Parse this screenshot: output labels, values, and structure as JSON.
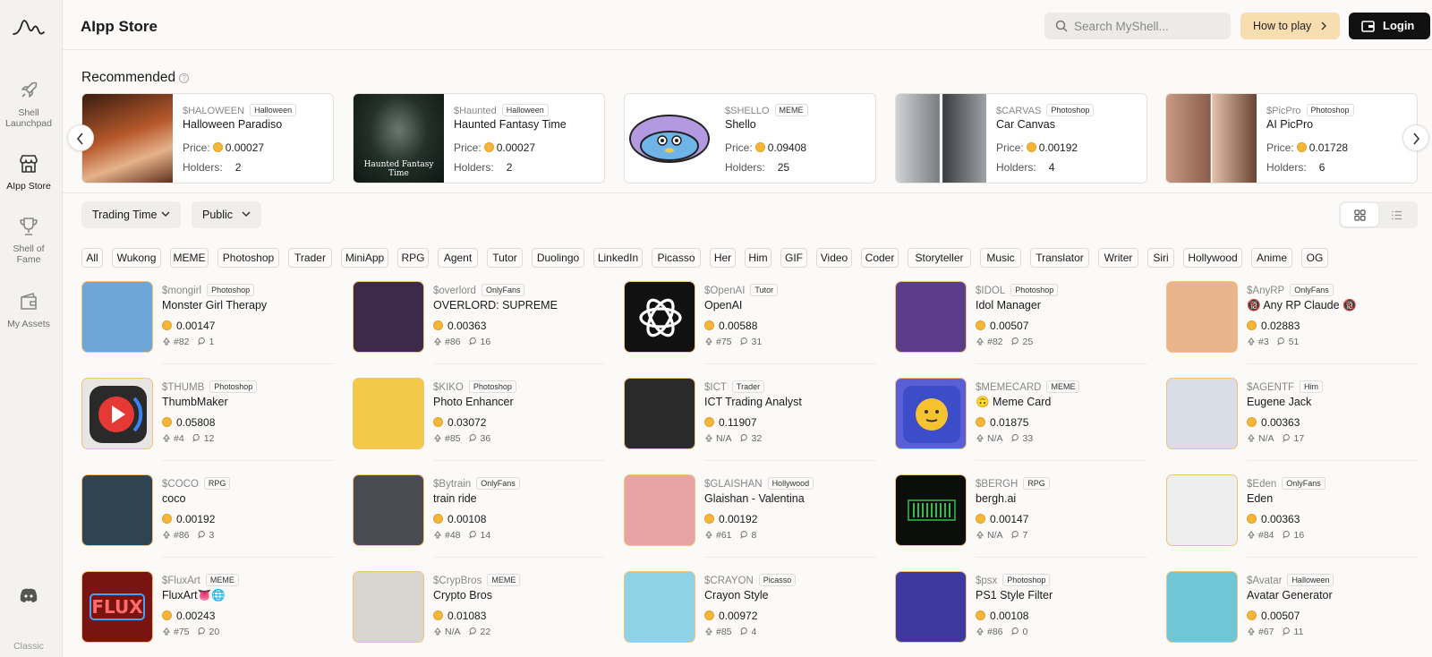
{
  "app": {
    "title": "AIpp Store"
  },
  "sidebar": {
    "items": [
      {
        "label_line1": "Shell",
        "label_line2": "Launchpad",
        "icon": "rocket-icon"
      },
      {
        "label_line1": "AIpp Store",
        "label_line2": "",
        "icon": "store-icon"
      },
      {
        "label_line1": "Shell of",
        "label_line2": "Fame",
        "icon": "trophy-icon"
      },
      {
        "label_line1": "My Assets",
        "label_line2": "",
        "icon": "wallet-icon"
      }
    ],
    "classic": "Classic"
  },
  "header": {
    "search_placeholder": "Search MyShell...",
    "how_to_play": "How to play",
    "login": "Login"
  },
  "recommended": {
    "title": "Recommended",
    "price_label": "Price:",
    "holders_label": "Holders:",
    "cards": [
      {
        "symbol": "$HALOWEEN",
        "tag": "Halloween",
        "name": "Halloween Paradiso",
        "price": "0.00027",
        "holders": "2",
        "img": "#7a3a20"
      },
      {
        "symbol": "$Haunted",
        "tag": "Halloween",
        "name": "Haunted Fantasy Time",
        "price": "0.00027",
        "holders": "2",
        "img": "#1d2a24",
        "caption": "Haunted Fantasy Time"
      },
      {
        "symbol": "$SHELLO",
        "tag": "MEME",
        "name": "Shello",
        "price": "0.09408",
        "holders": "25",
        "img": "#ffffff"
      },
      {
        "symbol": "$CARVAS",
        "tag": "Photoshop",
        "name": "Car Canvas",
        "price": "0.00192",
        "holders": "4",
        "img": "#8a8a8a"
      },
      {
        "symbol": "$PicPro",
        "tag": "Photoshop",
        "name": "AI PicPro",
        "price": "0.01728",
        "holders": "6",
        "img": "#b08a78"
      }
    ]
  },
  "filters": {
    "trading_time": "Trading Time",
    "visibility": "Public"
  },
  "categories": [
    "All",
    "Wukong",
    "MEME",
    "Photoshop",
    "Trader",
    "MiniApp",
    "RPG",
    "Agent",
    "Tutor",
    "Duolingo",
    "LinkedIn",
    "Picasso",
    "Her",
    "Him",
    "GIF",
    "Video",
    "Coder",
    "Storyteller",
    "Music",
    "Translator",
    "Writer",
    "Siri",
    "Hollywood",
    "Anime",
    "OG"
  ],
  "items": [
    {
      "symbol": "$mongirl",
      "tag": "Photoshop",
      "name": "Monster Girl Therapy",
      "price": "0.00147",
      "rank": "#82",
      "comments": "1",
      "color": "#6fa6d8"
    },
    {
      "symbol": "$overlord",
      "tag": "OnlyFans",
      "name": "OVERLORD: SUPREME",
      "price": "0.00363",
      "rank": "#86",
      "comments": "16",
      "color": "#3b2a4a"
    },
    {
      "symbol": "$OpenAI",
      "tag": "Tutor",
      "name": "OpenAI",
      "price": "0.00588",
      "rank": "#75",
      "comments": "31",
      "color": "#111111"
    },
    {
      "symbol": "$IDOL",
      "tag": "Photoshop",
      "name": "Idol Manager",
      "price": "0.00507",
      "rank": "#82",
      "comments": "25",
      "color": "#5a3c8a"
    },
    {
      "symbol": "$AnyRP",
      "tag": "OnlyFans",
      "name": "🔞 Any RP Claude 🔞",
      "price": "0.02883",
      "rank": "#3",
      "comments": "51",
      "color": "#e9b48a"
    },
    {
      "symbol": "$THUMB",
      "tag": "Photoshop",
      "name": "ThumbMaker",
      "price": "0.05808",
      "rank": "#4",
      "comments": "12",
      "color": "#e8e6e3"
    },
    {
      "symbol": "$KIKO",
      "tag": "Photoshop",
      "name": "Photo Enhancer",
      "price": "0.03072",
      "rank": "#85",
      "comments": "36",
      "color": "#f3c94a"
    },
    {
      "symbol": "$ICT",
      "tag": "Trader",
      "name": "ICT Trading Analyst",
      "price": "0.11907",
      "rank": "N/A",
      "comments": "32",
      "color": "#2a2a2a"
    },
    {
      "symbol": "$MEMECARD",
      "tag": "MEME",
      "name": "🙃 Meme Card",
      "price": "0.01875",
      "rank": "N/A",
      "comments": "33",
      "color": "#5b5fd6"
    },
    {
      "symbol": "$AGENTF",
      "tag": "Him",
      "name": "Eugene Jack",
      "price": "0.00363",
      "rank": "N/A",
      "comments": "17",
      "color": "#d9dde6"
    },
    {
      "symbol": "$COCO",
      "tag": "RPG",
      "name": "coco",
      "price": "0.00192",
      "rank": "#86",
      "comments": "3",
      "color": "#2f4450"
    },
    {
      "symbol": "$Bytrain",
      "tag": "OnlyFans",
      "name": "train ride",
      "price": "0.00108",
      "rank": "#48",
      "comments": "14",
      "color": "#4a4a52"
    },
    {
      "symbol": "$GLAISHAN",
      "tag": "Hollywood",
      "name": "Glaishan - Valentina",
      "price": "0.00192",
      "rank": "#61",
      "comments": "8",
      "color": "#e8a4a4"
    },
    {
      "symbol": "$BERGH",
      "tag": "RPG",
      "name": "bergh.ai",
      "price": "0.00147",
      "rank": "N/A",
      "comments": "7",
      "color": "#0b0f0b"
    },
    {
      "symbol": "$Eden",
      "tag": "OnlyFans",
      "name": "Eden",
      "price": "0.00363",
      "rank": "#84",
      "comments": "16",
      "color": "#eeeeee"
    },
    {
      "symbol": "$FluxArt",
      "tag": "MEME",
      "name": "FluxArt👅🌐",
      "price": "0.00243",
      "rank": "#75",
      "comments": "20",
      "color": "#7a1410"
    },
    {
      "symbol": "$CrypBros",
      "tag": "MEME",
      "name": "Crypto Bros",
      "price": "0.01083",
      "rank": "N/A",
      "comments": "22",
      "color": "#d8d6d0"
    },
    {
      "symbol": "$CRAYON",
      "tag": "Picasso",
      "name": "Crayon Style",
      "price": "0.00972",
      "rank": "#85",
      "comments": "4",
      "color": "#8fd2e6"
    },
    {
      "symbol": "$psx",
      "tag": "Photoshop",
      "name": "PS1 Style Filter",
      "price": "0.00108",
      "rank": "#86",
      "comments": "0",
      "color": "#3c3aa0"
    },
    {
      "symbol": "$Avatar",
      "tag": "Halloween",
      "name": "Avatar Generator",
      "price": "0.00507",
      "rank": "#67",
      "comments": "11",
      "color": "#6fc7d6"
    }
  ],
  "colors": {
    "accent": "#f7ddb0",
    "login_bg": "#111111",
    "coin": "#f4b63a",
    "avatar_border": "#f0c27b"
  },
  "flux_text": "FLUX"
}
